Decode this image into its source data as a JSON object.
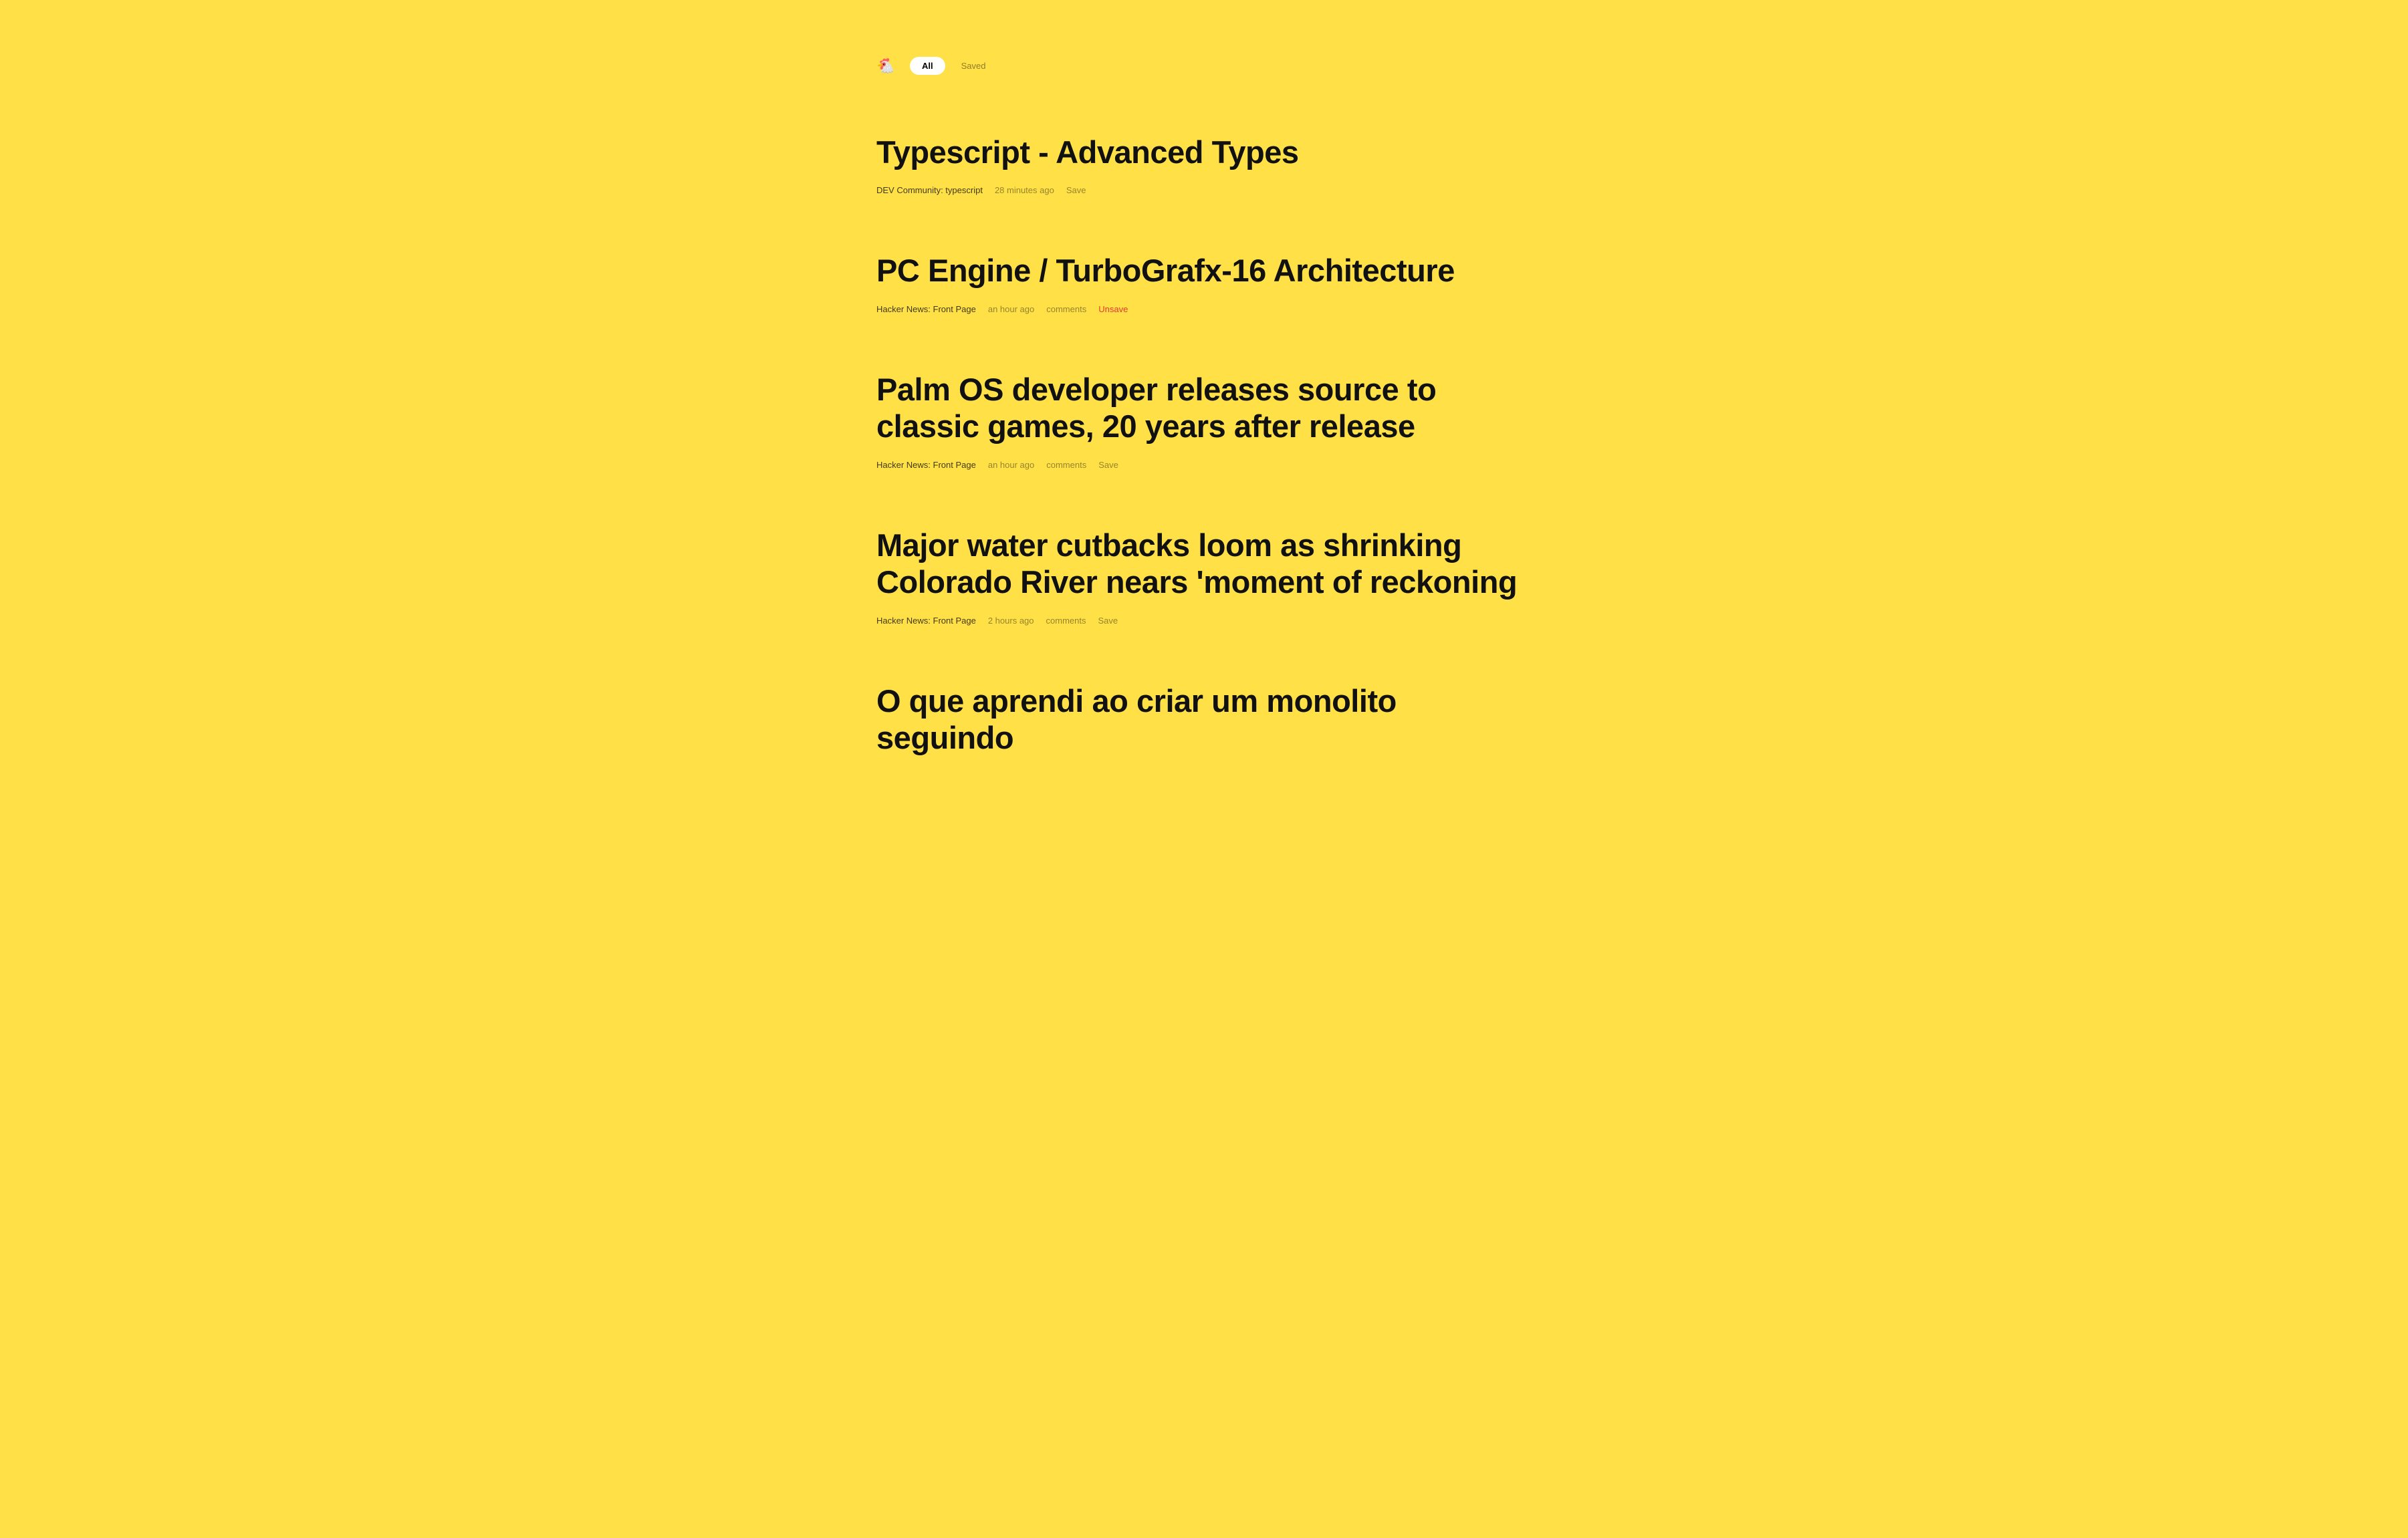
{
  "header": {
    "logo": "🐔",
    "tabs": {
      "all": "All",
      "saved": "Saved"
    }
  },
  "articles": [
    {
      "title": "Typescript - Advanced Types",
      "source": "DEV Community: typescript",
      "time": "28 minutes ago",
      "comments": "",
      "saveLabel": "Save",
      "saved": false
    },
    {
      "title": "PC Engine / TurboGrafx-16 Architecture",
      "source": "Hacker News: Front Page",
      "time": "an hour ago",
      "comments": "comments",
      "saveLabel": "Unsave",
      "saved": true
    },
    {
      "title": "Palm OS developer releases source to classic games, 20 years after release",
      "source": "Hacker News: Front Page",
      "time": "an hour ago",
      "comments": "comments",
      "saveLabel": "Save",
      "saved": false
    },
    {
      "title": "Major water cutbacks loom as shrinking Colorado River nears 'moment of reckoning",
      "source": "Hacker News: Front Page",
      "time": "2 hours ago",
      "comments": "comments",
      "saveLabel": "Save",
      "saved": false
    },
    {
      "title": "O que aprendi ao criar um monolito seguindo",
      "source": "",
      "time": "",
      "comments": "",
      "saveLabel": "",
      "saved": false
    }
  ]
}
